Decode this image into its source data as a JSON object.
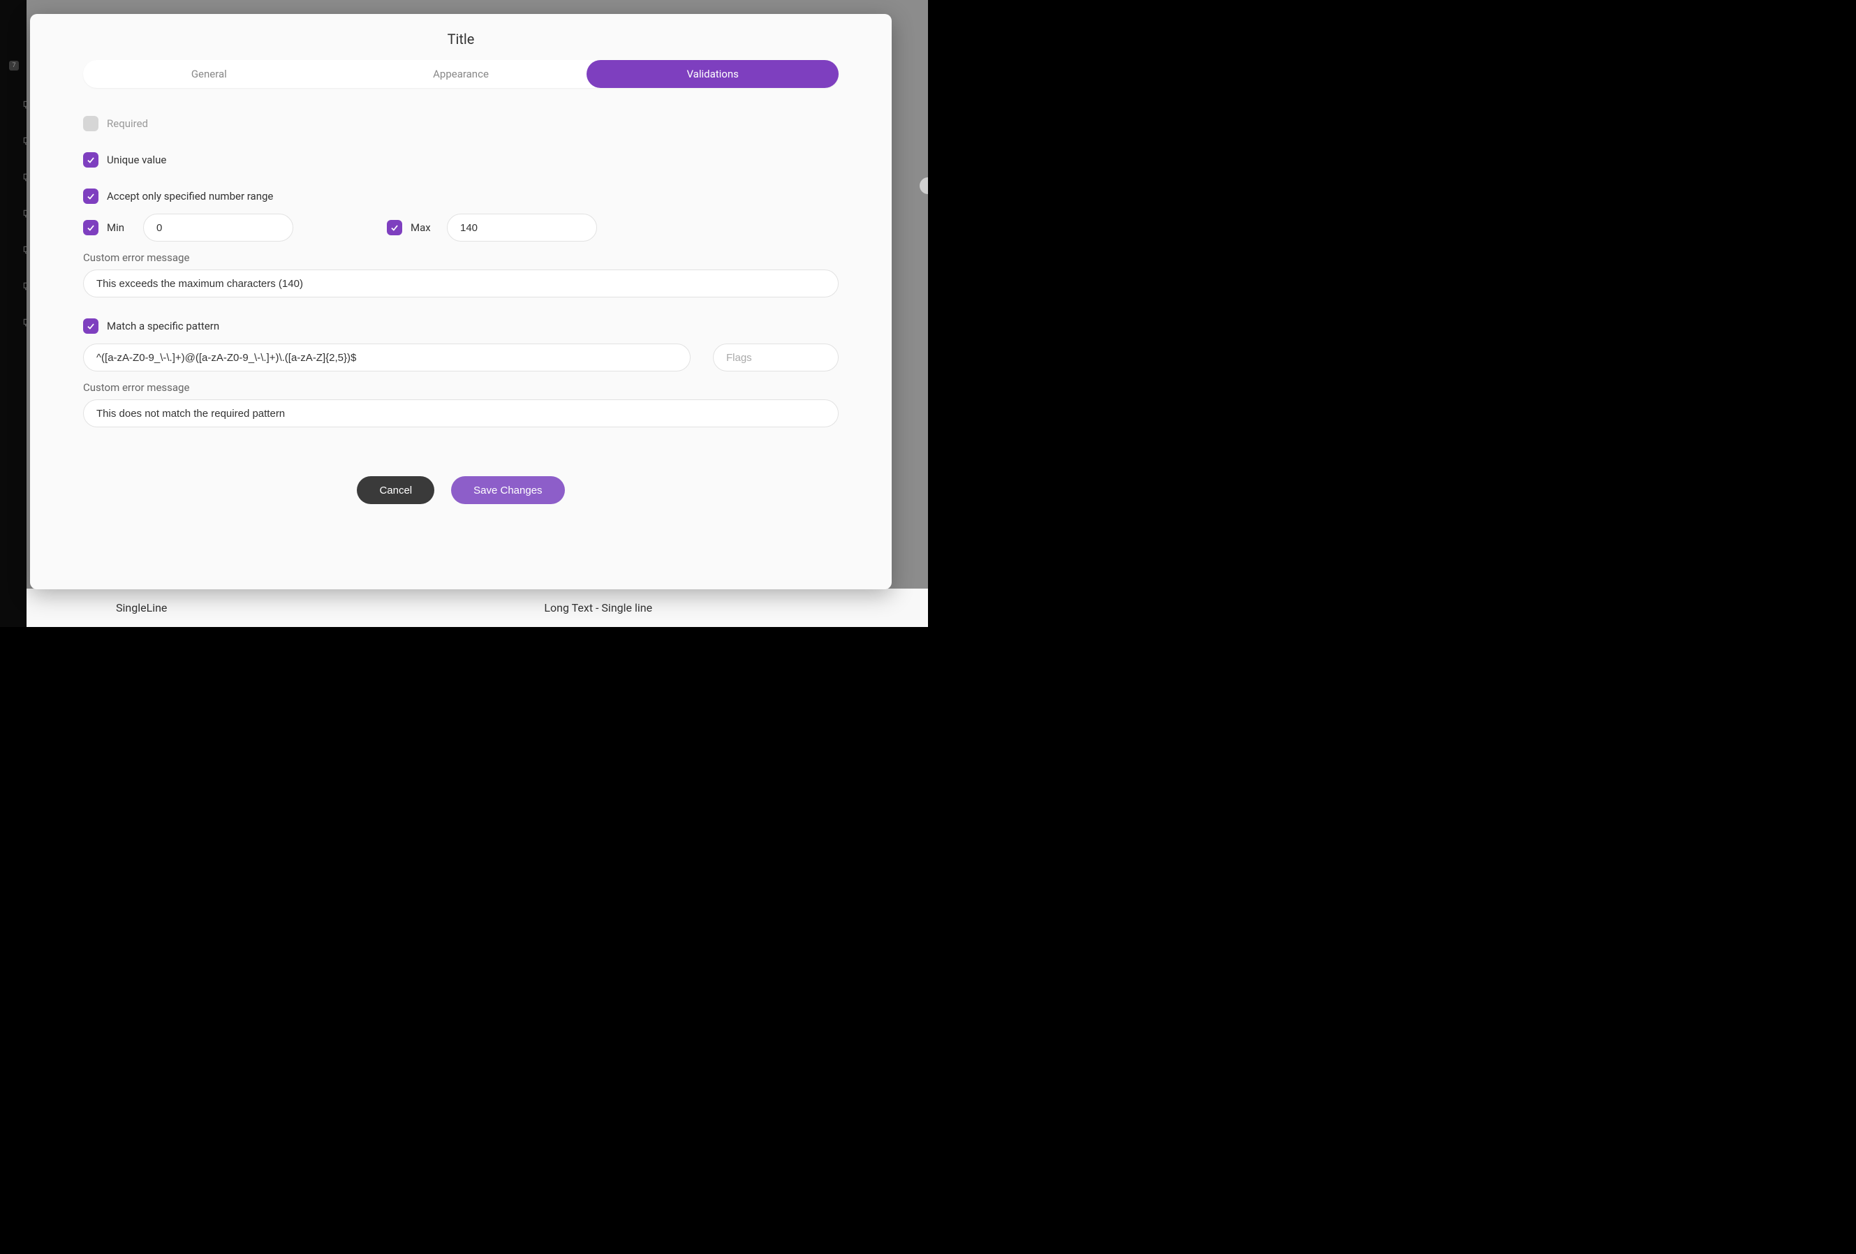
{
  "modal": {
    "title": "Title",
    "tabs": {
      "general": "General",
      "appearance": "Appearance",
      "validations": "Validations"
    },
    "required_label": "Required",
    "unique_label": "Unique value",
    "range_label": "Accept only specified number range",
    "min_label": "Min",
    "max_label": "Max",
    "min_value": "0",
    "max_value": "140",
    "custom_err_label": "Custom error message",
    "range_err_value": "This exceeds the maximum characters (140)",
    "pattern_label": "Match a specific pattern",
    "pattern_value": "^([a-zA-Z0-9_\\-\\.]+)@([a-zA-Z0-9_\\-\\.]+)\\.([a-zA-Z]{2,5})$",
    "flags_placeholder": "Flags",
    "pattern_err_value": "This does not match the required pattern",
    "cancel": "Cancel",
    "save": "Save Changes"
  },
  "background": {
    "badge": "7",
    "row_left": "SingleLine",
    "row_right": "Long Text - Single line"
  }
}
